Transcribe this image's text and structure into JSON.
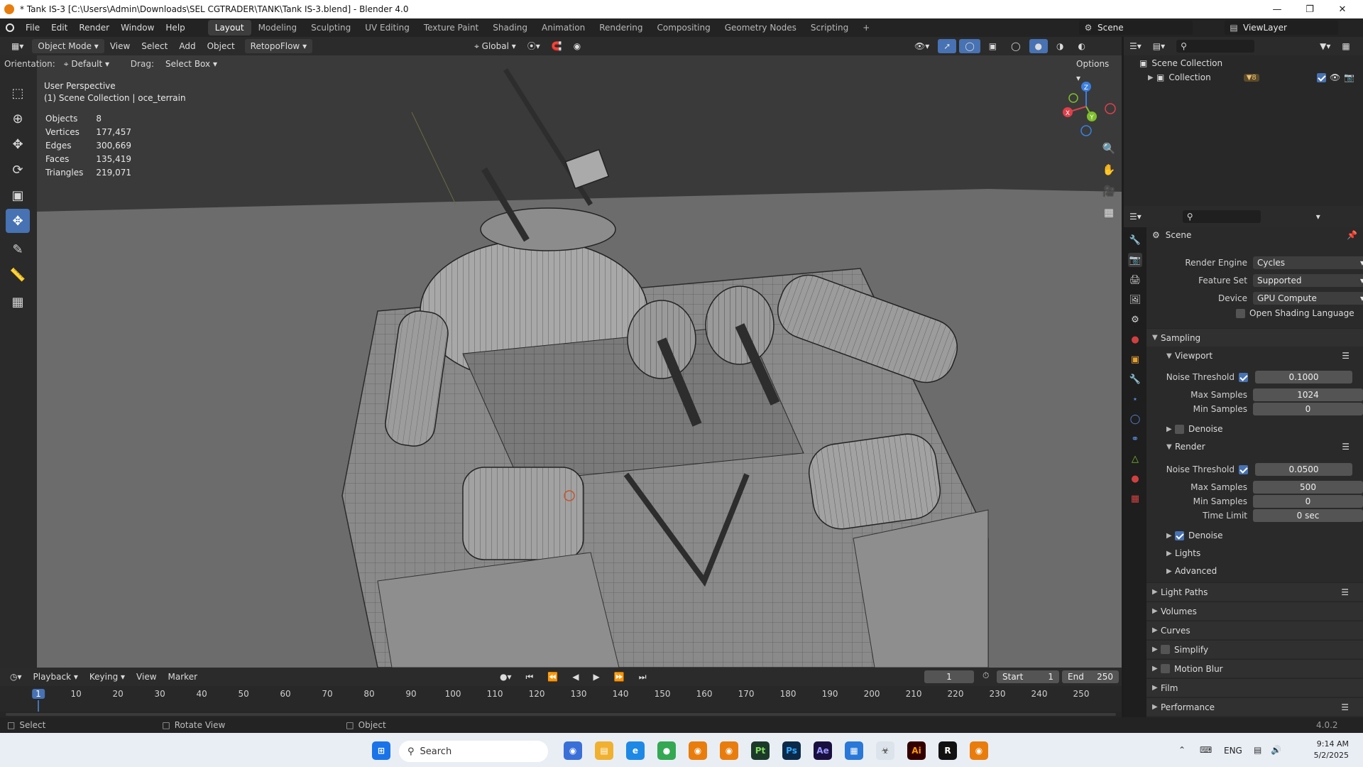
{
  "window": {
    "title": "* Tank IS-3 [C:\\Users\\Admin\\Downloads\\SEL CGTRADER\\TANK\\Tank IS-3.blend] - Blender 4.0"
  },
  "menus": [
    "File",
    "Edit",
    "Render",
    "Window",
    "Help"
  ],
  "workspaces": [
    "Layout",
    "Modeling",
    "Sculpting",
    "UV Editing",
    "Texture Paint",
    "Shading",
    "Animation",
    "Rendering",
    "Compositing",
    "Geometry Nodes",
    "Scripting"
  ],
  "active_workspace": "Layout",
  "scene_selector": "Scene",
  "view_layer": "ViewLayer",
  "header3d": {
    "mode": "Object Mode",
    "menus": [
      "View",
      "Select",
      "Add",
      "Object"
    ],
    "addon": "RetopoFlow",
    "transform_orientation": "Global"
  },
  "toolsettings": {
    "orientation_label": "Orientation:",
    "orientation_value": "Default",
    "drag_label": "Drag:",
    "drag_value": "Select Box",
    "options": "Options"
  },
  "viewport": {
    "view_name": "User Perspective",
    "collection_info": "(1) Scene Collection | oce_terrain",
    "stats": [
      {
        "label": "Objects",
        "value": "8"
      },
      {
        "label": "Vertices",
        "value": "177,457"
      },
      {
        "label": "Edges",
        "value": "300,669"
      },
      {
        "label": "Faces",
        "value": "135,419"
      },
      {
        "label": "Triangles",
        "value": "219,071"
      }
    ],
    "gizmo": {
      "x": "X",
      "y": "Y",
      "z": "Z"
    }
  },
  "outliner": {
    "root": "Scene Collection",
    "items": [
      {
        "label": "Collection",
        "count": "8"
      }
    ]
  },
  "properties": {
    "context": "Scene",
    "render_engine_label": "Render Engine",
    "render_engine": "Cycles",
    "feature_set_label": "Feature Set",
    "feature_set": "Supported",
    "device_label": "Device",
    "device": "GPU Compute",
    "osl_label": "Open Shading Language",
    "sampling": "Sampling",
    "viewport": "Viewport",
    "vp_noise_label": "Noise Threshold",
    "vp_noise": "0.1000",
    "vp_max_label": "Max Samples",
    "vp_max": "1024",
    "vp_min_label": "Min Samples",
    "vp_min": "0",
    "vp_denoise": "Denoise",
    "render": "Render",
    "r_noise_label": "Noise Threshold",
    "r_noise": "0.0500",
    "r_max_label": "Max Samples",
    "r_max": "500",
    "r_min_label": "Min Samples",
    "r_min": "0",
    "r_time_label": "Time Limit",
    "r_time": "0 sec",
    "r_denoise": "Denoise",
    "lights": "Lights",
    "advanced": "Advanced",
    "sections": [
      "Light Paths",
      "Volumes",
      "Curves",
      "Simplify",
      "Motion Blur",
      "Film",
      "Performance"
    ]
  },
  "timeline": {
    "menus": [
      "Playback",
      "Keying",
      "View",
      "Marker"
    ],
    "current_frame": "1",
    "start_label": "Start",
    "start": "1",
    "end_label": "End",
    "end": "250",
    "ticks": [
      "1",
      "10",
      "20",
      "30",
      "40",
      "50",
      "60",
      "70",
      "80",
      "90",
      "100",
      "110",
      "120",
      "130",
      "140",
      "150",
      "160",
      "170",
      "180",
      "190",
      "200",
      "210",
      "220",
      "230",
      "240",
      "250"
    ]
  },
  "statusbar": {
    "left": "Select",
    "middle": "Rotate View",
    "right": "Object",
    "version": "4.0.2"
  },
  "taskbar": {
    "search": "Search",
    "lang": "ENG",
    "time": "9:14 AM",
    "date": "5/2/2025",
    "apps": [
      "Pt",
      "Ps",
      "Ae",
      "Ai"
    ]
  },
  "colors": {
    "accent": "#4772b3",
    "blender_orange": "#e87d0d",
    "axis_x": "#e0404a",
    "axis_y": "#7fbf2a",
    "axis_z": "#3a80e0"
  }
}
